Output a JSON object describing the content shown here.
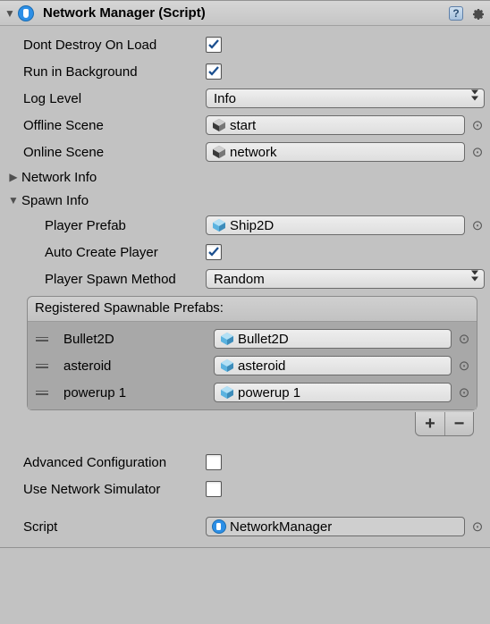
{
  "header": {
    "title": "Network Manager (Script)"
  },
  "props": {
    "dontDestroy": {
      "label": "Dont Destroy On Load",
      "checked": true
    },
    "runInBg": {
      "label": "Run in Background",
      "checked": true
    },
    "logLevel": {
      "label": "Log Level",
      "value": "Info"
    },
    "offlineScene": {
      "label": "Offline Scene",
      "value": "start"
    },
    "onlineScene": {
      "label": "Online Scene",
      "value": "network"
    }
  },
  "sections": {
    "networkInfo": "Network Info",
    "spawnInfo": "Spawn Info"
  },
  "spawn": {
    "playerPrefab": {
      "label": "Player Prefab",
      "value": "Ship2D"
    },
    "autoCreate": {
      "label": "Auto Create Player",
      "checked": true
    },
    "spawnMethod": {
      "label": "Player Spawn Method",
      "value": "Random"
    },
    "listTitle": "Registered Spawnable Prefabs:",
    "items": [
      {
        "name": "Bullet2D",
        "object": "Bullet2D"
      },
      {
        "name": "asteroid",
        "object": "asteroid"
      },
      {
        "name": "powerup 1",
        "object": "powerup 1"
      }
    ]
  },
  "advanced": {
    "config": {
      "label": "Advanced Configuration",
      "checked": false
    },
    "simulator": {
      "label": "Use Network Simulator",
      "checked": false
    }
  },
  "script": {
    "label": "Script",
    "value": "NetworkManager"
  }
}
